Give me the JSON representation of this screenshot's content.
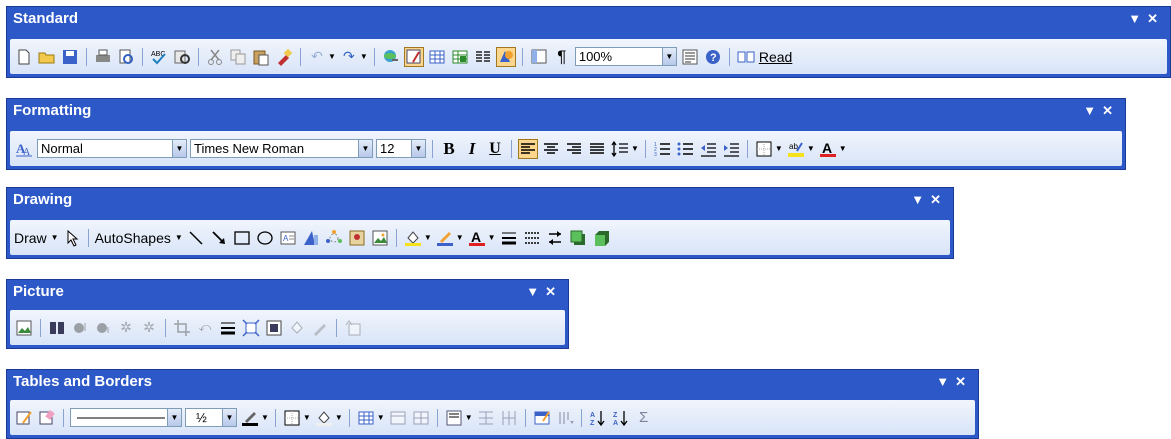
{
  "toolbars": {
    "standard": {
      "title": "Standard",
      "zoom_value": "100%",
      "read_label": "Read"
    },
    "formatting": {
      "title": "Formatting",
      "style_value": "Normal",
      "font_value": "Times New Roman",
      "size_value": "12",
      "bold_label": "B",
      "italic_label": "I",
      "underline_label": "U"
    },
    "drawing": {
      "title": "Drawing",
      "draw_label": "Draw",
      "autoshapes_label": "AutoShapes"
    },
    "picture": {
      "title": "Picture"
    },
    "tables": {
      "title": "Tables and Borders",
      "line_weight_value": "½"
    }
  },
  "colors": {
    "title_bar": "#2d58c8",
    "body_gradient_top": "#f1f5fc",
    "body_gradient_bottom": "#d8e4f8",
    "active_button": "#fbd68c",
    "font_color_underline": "#e02020",
    "highlight_color": "#f6e21a"
  }
}
